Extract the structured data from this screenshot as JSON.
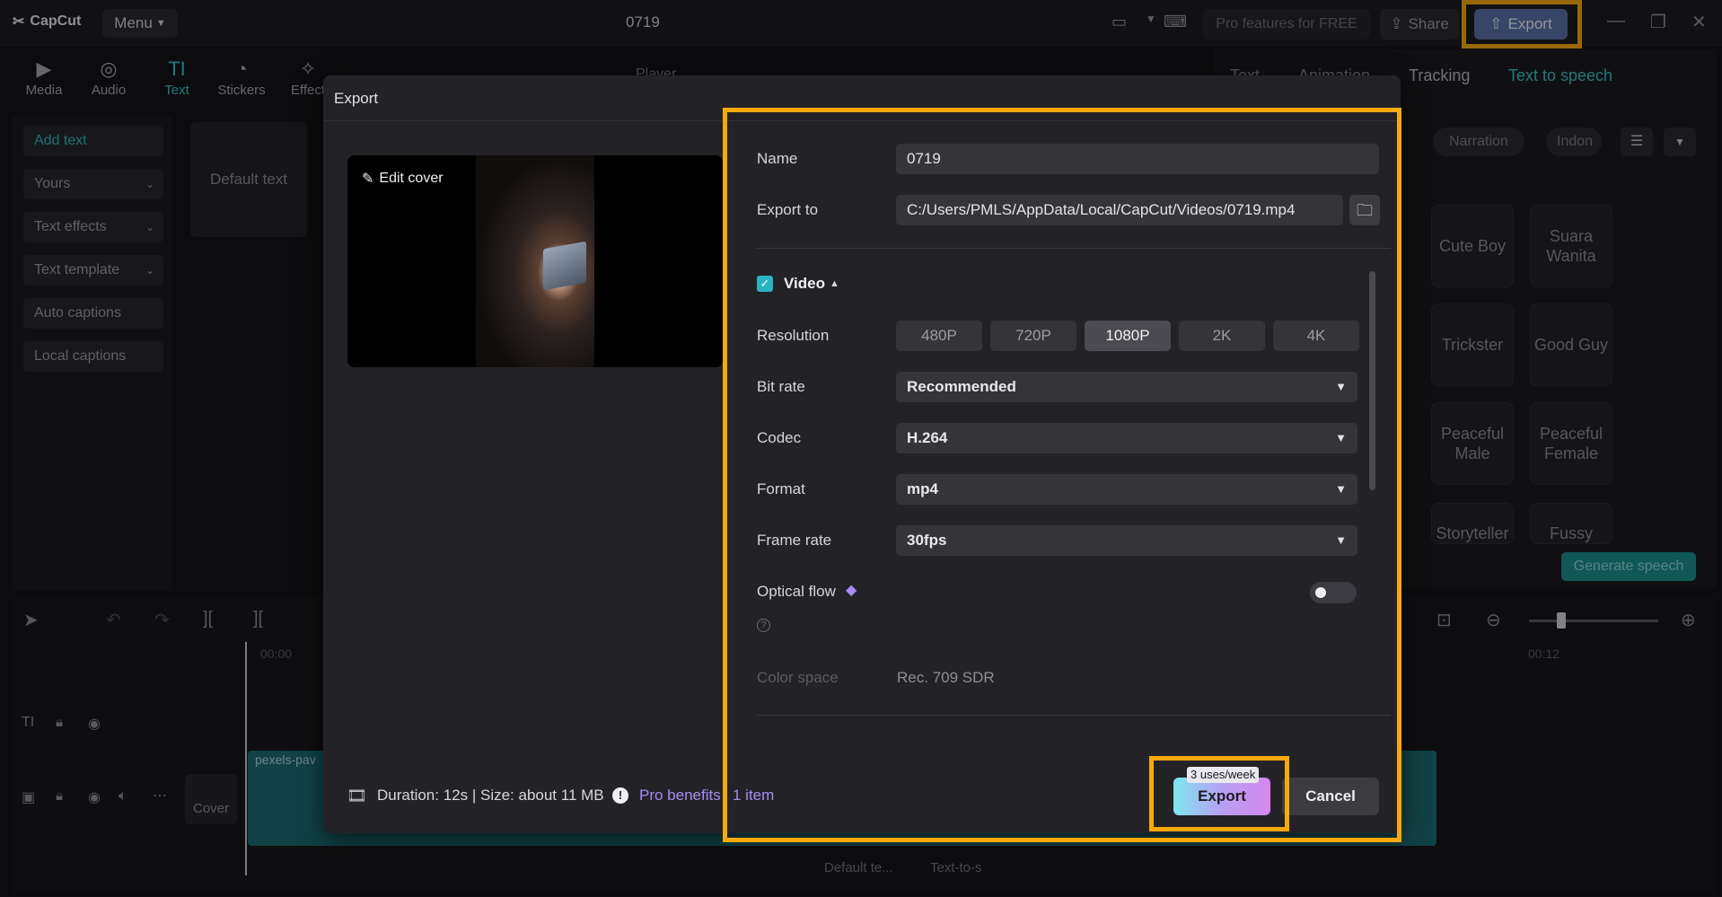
{
  "app": {
    "brand": "CapCut",
    "menu_label": "Menu",
    "project_title": "0719"
  },
  "topbar": {
    "pro_features": "Pro features for FREE",
    "share_label": "Share",
    "export_label": "Export"
  },
  "tools": [
    {
      "label": "Media",
      "icon": "media-icon"
    },
    {
      "label": "Audio",
      "icon": "audio-icon"
    },
    {
      "label": "Text",
      "icon": "text-icon"
    },
    {
      "label": "Stickers",
      "icon": "stickers-icon"
    },
    {
      "label": "Effect",
      "icon": "effects-icon"
    }
  ],
  "left_nav": {
    "add_text": "Add text",
    "yours": "Yours",
    "text_effects": "Text effects",
    "text_template": "Text template",
    "auto_captions": "Auto captions",
    "local_captions": "Local captions",
    "default_text": "Default text"
  },
  "right_panel": {
    "tabs": [
      "Text",
      "Animation",
      "Tracking",
      "Text to speech"
    ],
    "filters": [
      "Narration",
      "Indon"
    ],
    "voices": [
      "Cute Boy",
      "Suara Wanita",
      "Trickster",
      "Good Guy",
      "Peaceful Male",
      "Peaceful Female",
      "Storyteller",
      "Fussy"
    ],
    "generate_label": "Generate speech"
  },
  "player": {
    "label": "Player"
  },
  "timeline": {
    "time_start": "00:00",
    "time_end": "00:12",
    "clip_label": "pexels-pav",
    "cover_label": "Cover",
    "bottom_items": [
      "Default te...",
      "Text-to-s"
    ]
  },
  "dialog": {
    "title": "Export",
    "edit_cover": "Edit cover",
    "name_label": "Name",
    "name_value": "0719",
    "export_to_label": "Export to",
    "export_to_value": "C:/Users/PMLS/AppData/Local/CapCut/Videos/0719.mp4",
    "video_label": "Video",
    "resolution_label": "Resolution",
    "resolutions": [
      "480P",
      "720P",
      "1080P",
      "2K",
      "4K"
    ],
    "selected_resolution": "1080P",
    "bitrate_label": "Bit rate",
    "bitrate_value": "Recommended",
    "codec_label": "Codec",
    "codec_value": "H.264",
    "format_label": "Format",
    "format_value": "mp4",
    "framerate_label": "Frame rate",
    "framerate_value": "30fps",
    "optical_flow_label": "Optical flow",
    "colorspace_label": "Color space",
    "colorspace_value": "Rec. 709 SDR",
    "footer_info": "Duration: 12s | Size: about 11 MB",
    "pro_benefits": "Pro benefits",
    "pro_items": "1 item",
    "uses_badge": "3 uses/week",
    "export_button": "Export",
    "cancel_button": "Cancel"
  },
  "colors": {
    "accent": "#34c3c7",
    "highlight": "#f7a90b",
    "pro": "#a98cf3"
  }
}
